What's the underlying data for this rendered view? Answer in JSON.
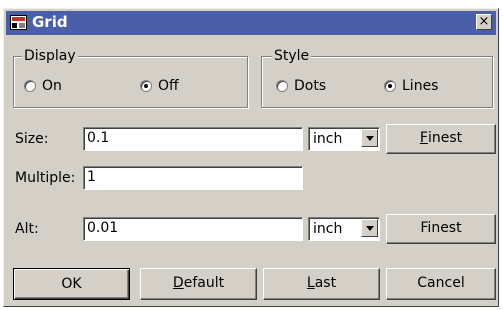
{
  "window": {
    "title": "Grid",
    "close_glyph": "×"
  },
  "display": {
    "legend": "Display",
    "options": [
      {
        "label": "On",
        "checked": false
      },
      {
        "label": "Off",
        "checked": true
      }
    ]
  },
  "style": {
    "legend": "Style",
    "options": [
      {
        "label": "Dots",
        "checked": false
      },
      {
        "label": "Lines",
        "checked": true
      }
    ]
  },
  "size": {
    "label": "Size:",
    "value": "0.1",
    "unit": "inch",
    "button_prefix": "",
    "button_mnemonic": "F",
    "button_rest": "inest"
  },
  "multiple": {
    "label": "Multiple:",
    "value": "1"
  },
  "alt": {
    "label": "Alt:",
    "value": "0.01",
    "unit": "inch",
    "button": "Finest"
  },
  "buttons": {
    "ok": "OK",
    "default_mnemonic": "D",
    "default_rest": "efault",
    "last_mnemonic": "L",
    "last_rest": "ast",
    "cancel": "Cancel"
  },
  "colors": {
    "titlebar": "#4a5fa8",
    "dialog_bg": "#d4d0c8"
  }
}
